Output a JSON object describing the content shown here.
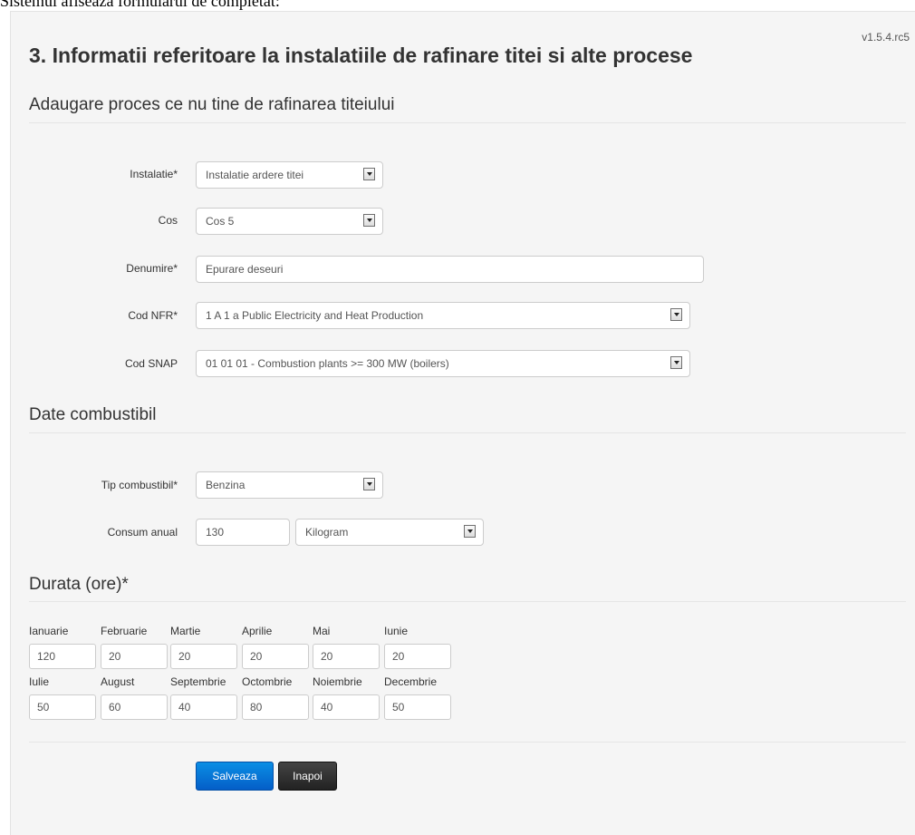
{
  "doc_caption": "Sistemul afiseaza formularul de completat:",
  "version": "v1.5.4.rc5",
  "page_title": "3. Informatii referitoare la instalatiile de rafinare titei si alte procese",
  "section_process": "Adaugare proces ce nu tine de rafinarea titeiului",
  "fields": {
    "instalatie": {
      "label": "Instalatie*",
      "value": "Instalatie ardere titei"
    },
    "cos": {
      "label": "Cos",
      "value": "Cos 5"
    },
    "denumire": {
      "label": "Denumire*",
      "value": "Epurare deseuri"
    },
    "cod_nfr": {
      "label": "Cod NFR*",
      "value": "1 A 1 a Public Electricity and Heat Production"
    },
    "cod_snap": {
      "label": "Cod SNAP",
      "value": "01 01 01 - Combustion plants >= 300 MW (boilers)"
    }
  },
  "section_fuel": "Date combustibil",
  "fuel": {
    "tip": {
      "label": "Tip combustibil*",
      "value": "Benzina"
    },
    "consum": {
      "label": "Consum anual",
      "value": "130",
      "unit": "Kilogram"
    }
  },
  "section_duration": "Durata (ore)*",
  "months": [
    {
      "label": "Ianuarie",
      "value": "120"
    },
    {
      "label": "Februarie",
      "value": "20"
    },
    {
      "label": "Martie",
      "value": "20"
    },
    {
      "label": "Aprilie",
      "value": "20"
    },
    {
      "label": "Mai",
      "value": "20"
    },
    {
      "label": "Iunie",
      "value": "20"
    },
    {
      "label": "Iulie",
      "value": "50"
    },
    {
      "label": "August",
      "value": "60"
    },
    {
      "label": "Septembrie",
      "value": "40"
    },
    {
      "label": "Octombrie",
      "value": "80"
    },
    {
      "label": "Noiembrie",
      "value": "40"
    },
    {
      "label": "Decembrie",
      "value": "50"
    }
  ],
  "buttons": {
    "save": "Salveaza",
    "back": "Inapoi"
  }
}
